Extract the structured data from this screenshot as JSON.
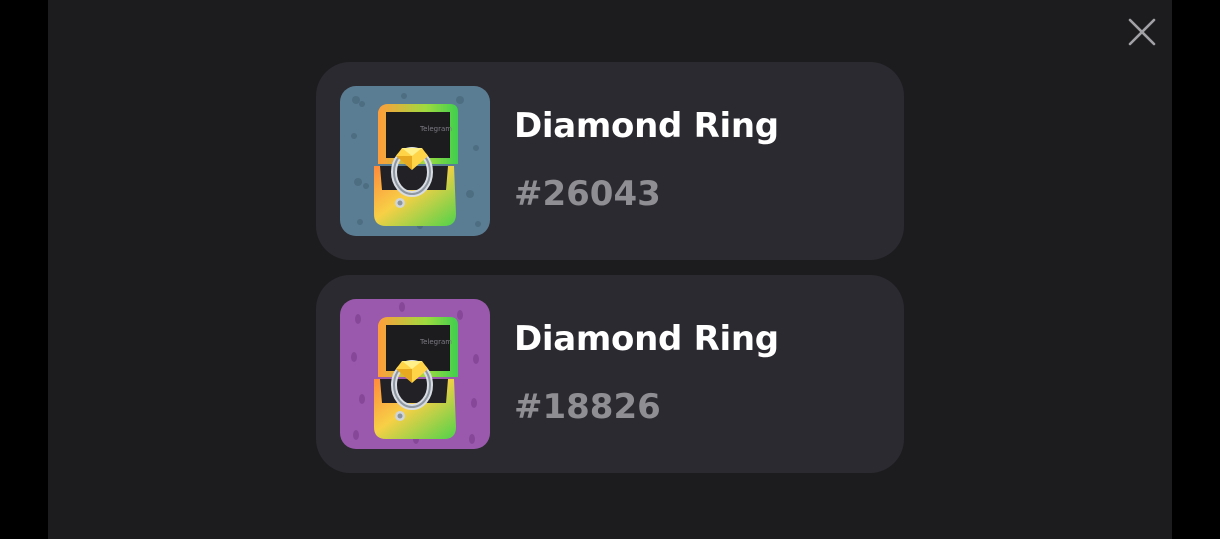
{
  "colors": {
    "page_bg": "#000000",
    "modal_bg": "#1c1c1e",
    "card_bg": "#2b2a30",
    "title_color": "#ffffff",
    "number_color": "#8e8e93",
    "close_color": "#a1a1a6"
  },
  "close": {
    "icon": "close-icon"
  },
  "gifts": [
    {
      "name": "Diamond Ring",
      "number": "#26043",
      "background_color": "#5b7d93",
      "pattern_color": "#4a6a7e",
      "icon": "diamond-ring-box-icon",
      "box_brand": "Telegram"
    },
    {
      "name": "Diamond Ring",
      "number": "#18826",
      "background_color": "#9a59ad",
      "pattern_color": "#834596",
      "icon": "diamond-ring-box-icon",
      "box_brand": "Telegram"
    }
  ]
}
